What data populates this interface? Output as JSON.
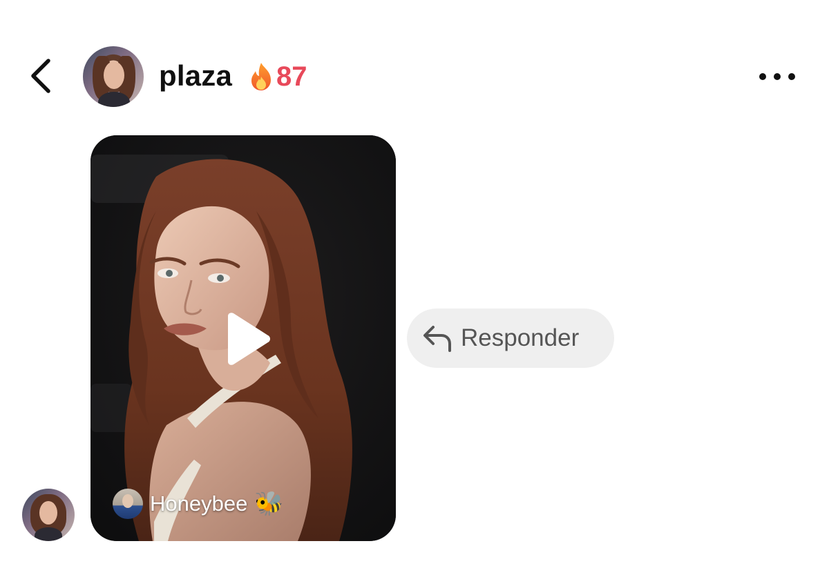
{
  "header": {
    "username": "plaza",
    "streak_count": "87",
    "streak_icon": "fire-icon",
    "back_icon": "chevron-left-icon",
    "more_icon": "more-horizontal-icon"
  },
  "message": {
    "video_author": "Honeybee",
    "video_author_emoji": "🐝",
    "play_icon": "play-icon"
  },
  "reply": {
    "label": "Responder",
    "icon": "reply-arrow-icon"
  },
  "colors": {
    "streak_red": "#e8495a",
    "reply_bg": "#efefef",
    "card_bg": "#121213"
  }
}
